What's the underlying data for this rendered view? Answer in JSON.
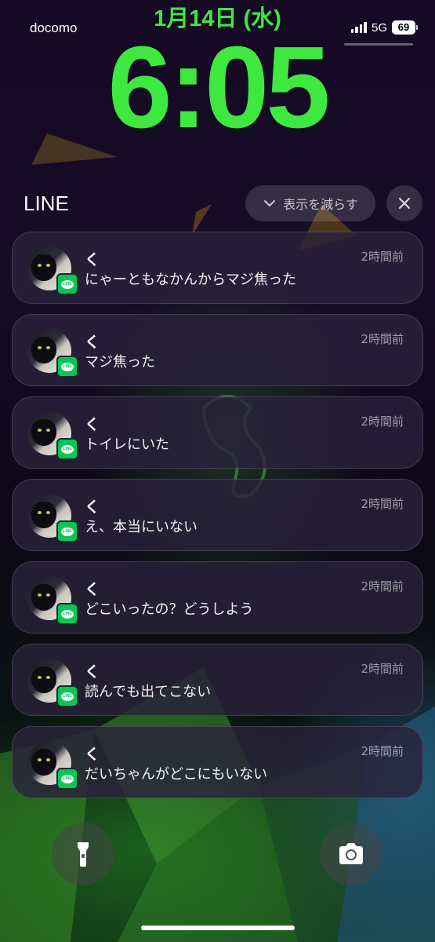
{
  "status_bar": {
    "carrier": "docomo",
    "date": "1月14日 (水)",
    "network": "5G",
    "battery": "69"
  },
  "lock_screen": {
    "time": "6:05"
  },
  "notification_group": {
    "app_name": "LINE",
    "show_less_label": "表示を減らす",
    "notifications": [
      {
        "sender": "く",
        "time": "2時間前",
        "message": "にゃーともなかんからマジ焦った"
      },
      {
        "sender": "く",
        "time": "2時間前",
        "message": "マジ焦った"
      },
      {
        "sender": "く",
        "time": "2時間前",
        "message": "トイレにいた"
      },
      {
        "sender": "く",
        "time": "2時間前",
        "message": "え、本当にいない"
      },
      {
        "sender": "く",
        "time": "2時間前",
        "message": "どこいったの？どうしよう"
      },
      {
        "sender": "く",
        "time": "2時間前",
        "message": "読んでも出てこない"
      },
      {
        "sender": "く",
        "time": "2時間前",
        "message": "だいちゃんがどこにもいない"
      }
    ]
  },
  "quick_actions": {
    "flashlight_icon": "flashlight-icon",
    "camera_icon": "camera-icon"
  },
  "colors": {
    "accent_green": "#3ee83e",
    "line_green": "#06c755"
  }
}
